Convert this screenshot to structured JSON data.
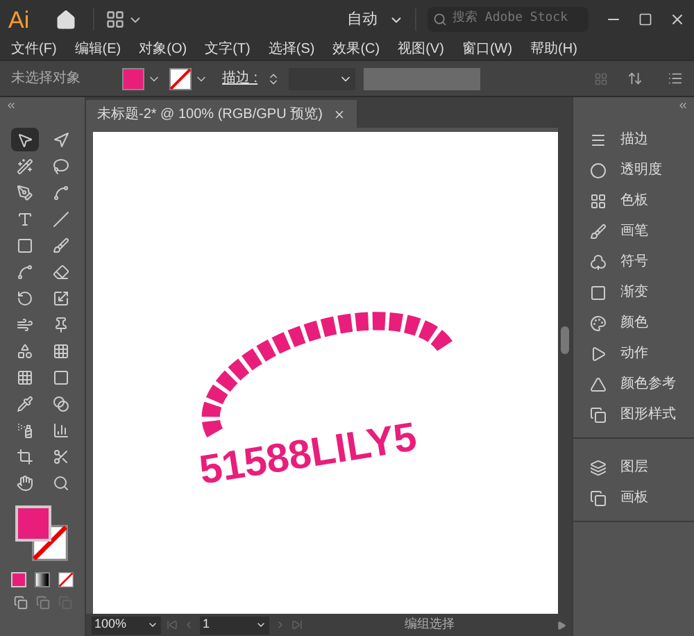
{
  "title_bar": {
    "logo": "Ai",
    "workspace": "自动",
    "search": {
      "placeholder": "搜索 Adobe Stock"
    }
  },
  "menu": [
    "文件(F)",
    "编辑(E)",
    "对象(O)",
    "文字(T)",
    "选择(S)",
    "效果(C)",
    "视图(V)",
    "窗口(W)",
    "帮助(H)"
  ],
  "control_bar": {
    "selection": "未选择对象",
    "fill": {
      "color": "#e91e7a"
    },
    "stroke_label": "描边 :"
  },
  "tools": [
    {
      "kind": "select",
      "selected": true
    },
    {
      "kind": "direct",
      "selected": false
    },
    {
      "kind": "wand",
      "selected": false
    },
    {
      "kind": "lasso",
      "selected": false
    },
    {
      "kind": "pen",
      "selected": false
    },
    {
      "kind": "curvature",
      "selected": false
    },
    {
      "kind": "type",
      "selected": false
    },
    {
      "kind": "line",
      "selected": false
    },
    {
      "kind": "rect",
      "selected": false
    },
    {
      "kind": "brush",
      "selected": false
    },
    {
      "kind": "shaper",
      "selected": false
    },
    {
      "kind": "eraser",
      "selected": false
    },
    {
      "kind": "rotate",
      "selected": false
    },
    {
      "kind": "scale",
      "selected": false
    },
    {
      "kind": "warp",
      "selected": false
    },
    {
      "kind": "pin",
      "selected": false
    },
    {
      "kind": "shapebuilder",
      "selected": false
    },
    {
      "kind": "perspective",
      "selected": false
    },
    {
      "kind": "mesh",
      "selected": false
    },
    {
      "kind": "gradient",
      "selected": false
    },
    {
      "kind": "eyedropper",
      "selected": false
    },
    {
      "kind": "blend",
      "selected": false
    },
    {
      "kind": "symbolsprayer",
      "selected": false
    },
    {
      "kind": "graph",
      "selected": false
    },
    {
      "kind": "artboard",
      "selected": false
    },
    {
      "kind": "slice",
      "selected": false
    },
    {
      "kind": "hand",
      "selected": false
    },
    {
      "kind": "zoom",
      "selected": false
    }
  ],
  "document_tab": {
    "title": "未标题-2* @ 100% (RGB/GPU 预览)"
  },
  "artwork": {
    "text": "51588LILY5",
    "color": "#e91e7a"
  },
  "panels": [
    {
      "kind": "stroke",
      "label": "描边"
    },
    {
      "kind": "transparency",
      "label": "透明度"
    },
    {
      "kind": "swatches",
      "label": "色板"
    },
    {
      "kind": "brushes",
      "label": "画笔"
    },
    {
      "kind": "symbols",
      "label": "符号"
    },
    {
      "kind": "gradient",
      "label": "渐变"
    },
    {
      "kind": "color",
      "label": "颜色"
    },
    {
      "kind": "actions",
      "label": "动作"
    },
    {
      "kind": "guide",
      "label": "颜色参考"
    },
    {
      "kind": "styles",
      "label": "图形样式"
    }
  ],
  "panels2": [
    {
      "kind": "layers",
      "label": "图层"
    },
    {
      "kind": "artboards",
      "label": "画板"
    }
  ],
  "status_bar": {
    "zoom": "100%",
    "page": "1",
    "tool": "编组选择"
  }
}
